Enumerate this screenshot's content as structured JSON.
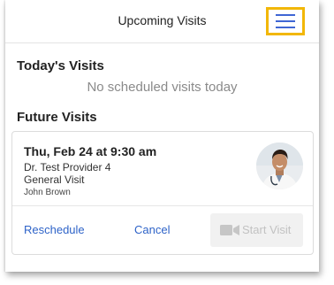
{
  "header": {
    "title": "Upcoming Visits",
    "menu_icon": "hamburger-menu-icon"
  },
  "today": {
    "heading": "Today's Visits",
    "empty_message": "No scheduled visits today"
  },
  "future": {
    "heading": "Future Visits",
    "visits": [
      {
        "datetime": "Thu, Feb 24 at 9:30 am",
        "provider": "Dr. Test Provider 4",
        "visit_type": "General Visit",
        "patient": "John Brown",
        "avatar": "provider-photo",
        "actions": {
          "reschedule": "Reschedule",
          "cancel": "Cancel",
          "start": "Start Visit",
          "start_icon": "video-camera-icon",
          "start_enabled": false
        }
      }
    ]
  },
  "colors": {
    "accent": "#2e63c8",
    "menu_highlight": "#f2b707",
    "menu_lines": "#3f66d4",
    "disabled_text": "#c2c2c2"
  }
}
